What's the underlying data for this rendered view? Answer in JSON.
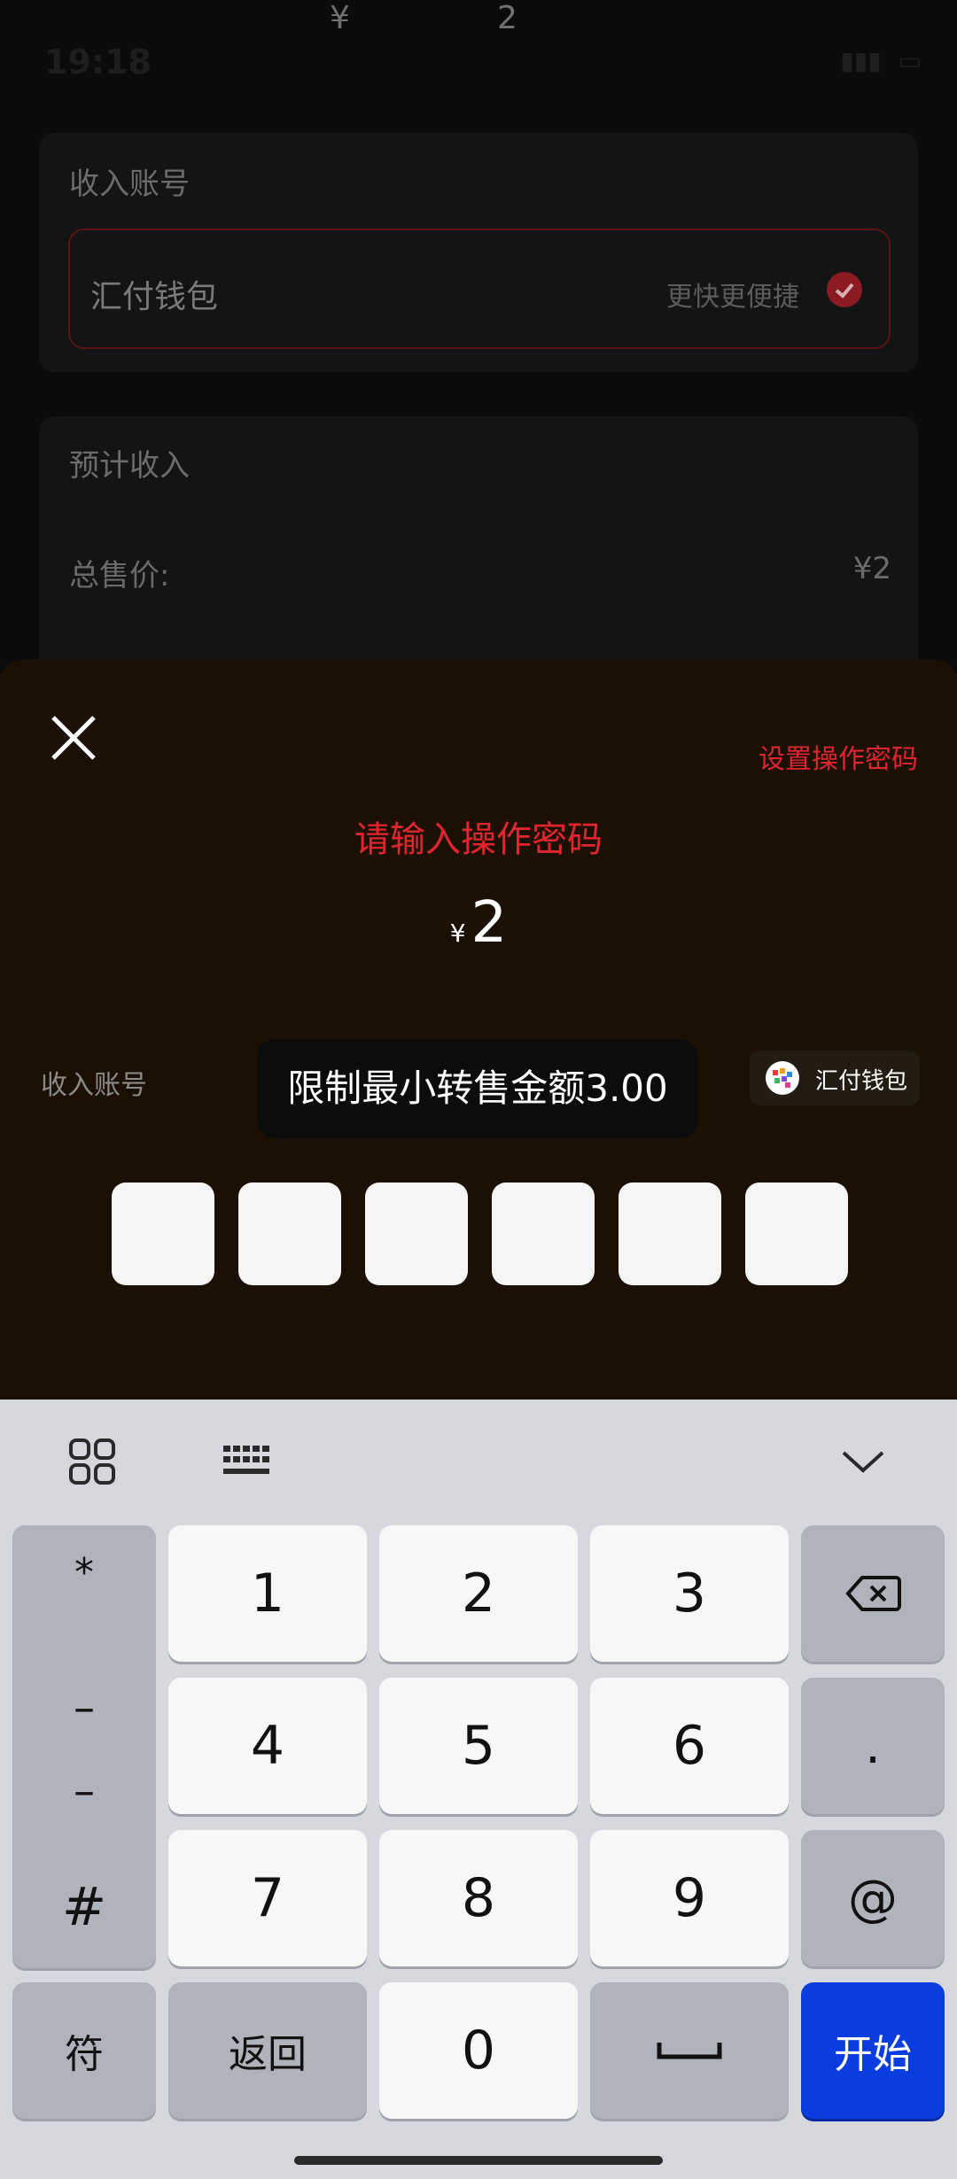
{
  "background": {
    "top_currency": "¥",
    "top_amount": "2",
    "status_time": "19:18",
    "receive_account_label": "收入账号",
    "wallet_name": "汇付钱包",
    "wallet_subtitle": "更快更便捷",
    "expected_income_label": "预计收入",
    "total_price_label": "总售价:",
    "total_price_value": "¥2"
  },
  "dialog": {
    "set_password_link": "设置操作密码",
    "title": "请输入操作密码",
    "currency_symbol": "¥",
    "amount": "2",
    "receive_account_label": "收入账号",
    "wallet_chip_label": "汇付钱包",
    "toast": "限制最小转售金额3.00",
    "password_boxes": [
      "",
      "",
      "",
      "",
      "",
      ""
    ]
  },
  "keyboard": {
    "left_column": [
      "*",
      "–",
      "–",
      "#"
    ],
    "keys_row1": [
      "1",
      "2",
      "3"
    ],
    "keys_row2": [
      "4",
      "5",
      "6"
    ],
    "keys_row3": [
      "7",
      "8",
      "9"
    ],
    "dot": ".",
    "at": "@",
    "symbols_key": "符",
    "back_key": "返回",
    "zero": "0",
    "start_key": "开始"
  },
  "colors": {
    "accent_red": "#e0252d",
    "start_key_blue": "#0a3de0",
    "sheet_bg": "#1c1005"
  }
}
